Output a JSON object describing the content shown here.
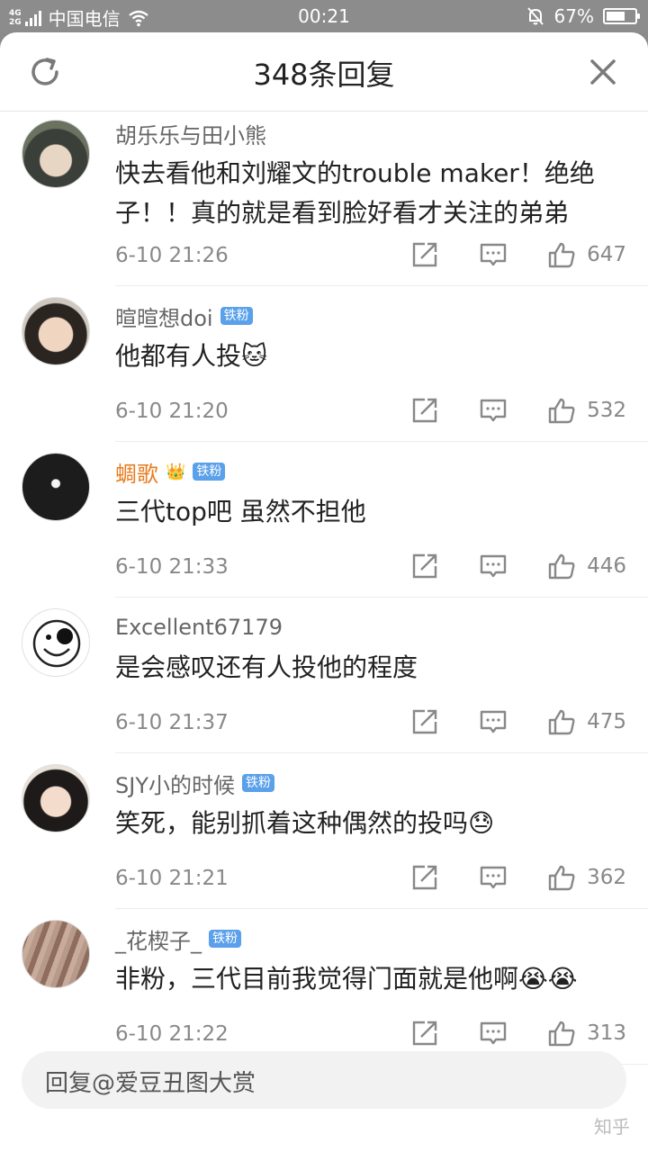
{
  "status_bar": {
    "net_top": "4G",
    "net_bottom": "2G",
    "carrier": "中国电信",
    "time": "00:21",
    "battery_pct": "67%",
    "battery_level": 0.67
  },
  "header": {
    "title": "348条回复",
    "refresh_icon": "refresh-icon",
    "close_icon": "close-icon"
  },
  "comments": [
    {
      "name": "胡乐乐与田小熊",
      "badge": "",
      "text": "快去看他和刘耀文的trouble maker！绝绝子！！真的就是看到脸好看才关注的弟弟",
      "time": "6-10 21:26",
      "likes": "647"
    },
    {
      "name": "暄暄想doi",
      "badge": "铁粉",
      "text": "他都有人投🐱",
      "time": "6-10 21:20",
      "likes": "532"
    },
    {
      "name": "蜩歌",
      "badge": "铁粉",
      "text": "三代top吧 虽然不担他",
      "time": "6-10 21:33",
      "likes": "446"
    },
    {
      "name": "Excellent67179",
      "badge": "",
      "text": "是会感叹还有人投他的程度",
      "time": "6-10 21:37",
      "likes": "475"
    },
    {
      "name": "SJY小的时候",
      "badge": "铁粉",
      "text": "笑死，能别抓着这种偶然的投吗😓",
      "time": "6-10 21:21",
      "likes": "362"
    },
    {
      "name": "_花楔子_",
      "badge": "铁粉",
      "text": "非粉，三代目前我觉得门面就是他啊😭😭",
      "time": "6-10 21:22",
      "likes": "313"
    }
  ],
  "reply": {
    "placeholder": "回复@爱豆丑图大赏"
  },
  "watermark": "知乎"
}
